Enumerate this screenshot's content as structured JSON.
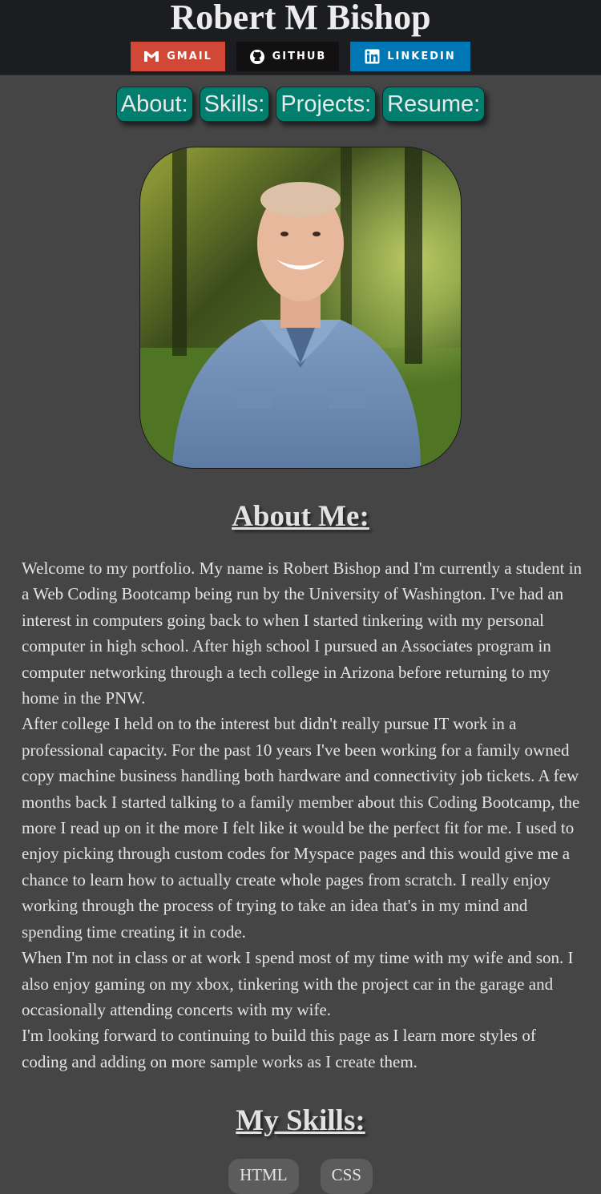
{
  "header": {
    "title": "Robert M Bishop",
    "badges": [
      {
        "label": "GMAIL",
        "icon": "gmail-icon",
        "color": "#d14836"
      },
      {
        "label": "GITHUB",
        "icon": "github-icon",
        "color": "#121011"
      },
      {
        "label": "LINKEDIN",
        "icon": "linkedin-icon",
        "color": "#0077b5"
      }
    ]
  },
  "nav": {
    "items": [
      {
        "label": "About:"
      },
      {
        "label": "Skills:"
      },
      {
        "label": "Projects:"
      },
      {
        "label": "Resume:"
      }
    ],
    "accent": "#017e6e"
  },
  "about": {
    "heading": "About Me:",
    "paragraphs": [
      "Welcome to my portfolio. My name is Robert Bishop and I'm currently a student in a Web Coding Bootcamp being run by the University of Washington. I've had an interest in computers going back to when I started tinkering with my personal computer in high school. After high school I pursued an Associates program in computer networking through a tech college in Arizona before returning to my home in the PNW.",
      "After college I held on to the interest but didn't really pursue IT work in a professional capacity. For the past 10 years I've been working for a family owned copy machine business handling both hardware and connectivity job tickets. A few months back I started talking to a family member about this Coding Bootcamp, the more I read up on it the more I felt like it would be the perfect fit for me. I used to enjoy picking through custom codes for Myspace pages and this would give me a chance to learn how to actually create whole pages from scratch. I really enjoy working through the process of trying to take an idea that's in my mind and spending time creating it in code.",
      "When I'm not in class or at work I spend most of my time with my wife and son. I also enjoy gaming on my xbox, tinkering with the project car in the garage and occasionally attending concerts with my wife.",
      "I'm looking forward to continuing to build this page as I learn more styles of coding and adding on more sample works as I create them."
    ]
  },
  "skills": {
    "heading": "My Skills:",
    "items": [
      "HTML",
      "CSS"
    ]
  },
  "colors": {
    "page_bg": "#454545",
    "header_bg": "#1b1d20"
  }
}
